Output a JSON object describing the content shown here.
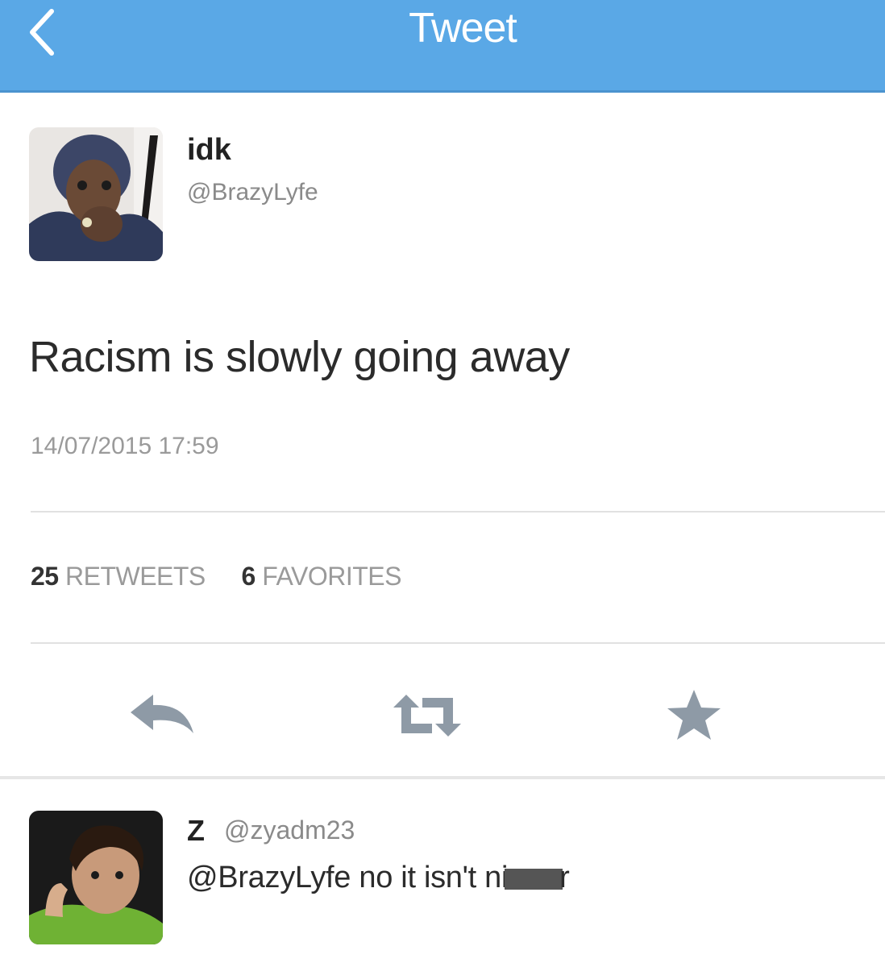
{
  "nav": {
    "title": "Tweet",
    "back_icon": "chevron-left-icon",
    "bar_color": "#5aa8e6"
  },
  "tweet": {
    "author_name": "idk",
    "author_handle": "@BrazyLyfe",
    "text": "Racism is slowly going away",
    "timestamp": "14/07/2015 17:59",
    "retweets_count": "25",
    "retweets_label": "RETWEETS",
    "favorites_count": "6",
    "favorites_label": "FAVORITES"
  },
  "actions": [
    {
      "name": "reply",
      "icon": "reply-icon"
    },
    {
      "name": "retweet",
      "icon": "retweet-icon"
    },
    {
      "name": "favorite",
      "icon": "star-icon"
    }
  ],
  "reply": {
    "author_name": "Z",
    "author_handle": "@zyadm23",
    "text_prefix": "@BrazyLyfe no it isn't ni",
    "text_suffix": "r"
  },
  "colors": {
    "icon_gray": "#8e9aa6",
    "text_dark": "#2b2b2b",
    "text_muted": "#9a9a9a"
  }
}
